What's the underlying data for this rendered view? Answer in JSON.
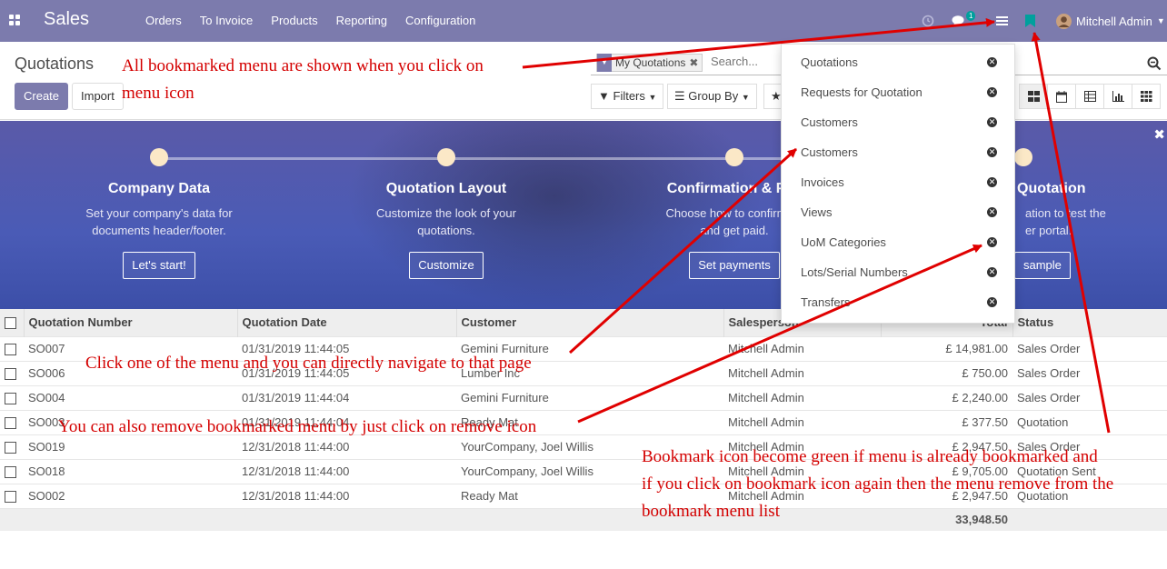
{
  "app": {
    "title": "Sales",
    "menu": [
      "Orders",
      "To Invoice",
      "Products",
      "Reporting",
      "Configuration"
    ],
    "messages_badge": "1",
    "user": "Mitchell Admin",
    "colors": {
      "navbar": "#7c7bad",
      "bookmark_active": "#00a09d",
      "annotation": "#d40000"
    }
  },
  "control": {
    "breadcrumb": "Quotations",
    "create_label": "Create",
    "import_label": "Import",
    "facet_label": "My Quotations",
    "search_placeholder": "Search...",
    "filters_label": "Filters",
    "groupby_label": "Group By"
  },
  "banner": {
    "steps": [
      {
        "title": "Company Data",
        "desc1": "Set your company's data for",
        "desc2": "documents header/footer.",
        "button": "Let's start!"
      },
      {
        "title": "Quotation Layout",
        "desc1": "Customize the look of your",
        "desc2": "quotations.",
        "button": "Customize"
      },
      {
        "title": "Confirmation & Pay",
        "desc1": "Choose how to confirm qu",
        "desc2": "and get paid.",
        "button": "Set payments"
      },
      {
        "title": "Quotation",
        "desc1": "ation to test the",
        "desc2": "er portal.",
        "button": "sample"
      }
    ]
  },
  "bookmarks": {
    "items": [
      "Quotations",
      "Requests for Quotation",
      "Customers",
      "Customers",
      "Invoices",
      "Views",
      "UoM Categories",
      "Lots/Serial Numbers",
      "Transfers"
    ]
  },
  "table": {
    "columns": [
      "Quotation Number",
      "Quotation Date",
      "Customer",
      "Salesperson",
      "Total",
      "Status"
    ],
    "rows": [
      {
        "number": "SO007",
        "date": "01/31/2019 11:44:05",
        "customer": "Gemini Furniture",
        "salesperson": "Mitchell Admin",
        "total": "£ 14,981.00",
        "status": "Sales Order"
      },
      {
        "number": "SO006",
        "date": "01/31/2019 11:44:05",
        "customer": "Lumber Inc",
        "salesperson": "Mitchell Admin",
        "total": "£ 750.00",
        "status": "Sales Order"
      },
      {
        "number": "SO004",
        "date": "01/31/2019 11:44:04",
        "customer": "Gemini Furniture",
        "salesperson": "Mitchell Admin",
        "total": "£ 2,240.00",
        "status": "Sales Order"
      },
      {
        "number": "SO003",
        "date": "01/31/2019 11:44:04",
        "customer": "Ready Mat",
        "salesperson": "Mitchell Admin",
        "total": "£ 377.50",
        "status": "Quotation"
      },
      {
        "number": "SO019",
        "date": "12/31/2018 11:44:00",
        "customer": "YourCompany, Joel Willis",
        "salesperson": "Mitchell Admin",
        "total": "£ 2,947.50",
        "status": "Sales Order"
      },
      {
        "number": "SO018",
        "date": "12/31/2018 11:44:00",
        "customer": "YourCompany, Joel Willis",
        "salesperson": "Mitchell Admin",
        "total": "£ 9,705.00",
        "status": "Quotation Sent"
      },
      {
        "number": "SO002",
        "date": "12/31/2018 11:44:00",
        "customer": "Ready Mat",
        "salesperson": "Mitchell Admin",
        "total": "£ 2,947.50",
        "status": "Quotation"
      }
    ],
    "grand_total": "33,948.50"
  },
  "annotations": {
    "bookmarks_shown_1": "All bookmarked menu are shown when you click on",
    "bookmarks_shown_2": "menu icon",
    "navigate": "Click one of the menu and you can directly navigate to that page",
    "remove": "You can also remove bookmarked menu by just click on remove icon",
    "green_1": "Bookmark icon become green if menu is already bookmarked and",
    "green_2": "if you click on bookmark icon again then the menu remove from the",
    "green_3": "bookmark menu list"
  }
}
